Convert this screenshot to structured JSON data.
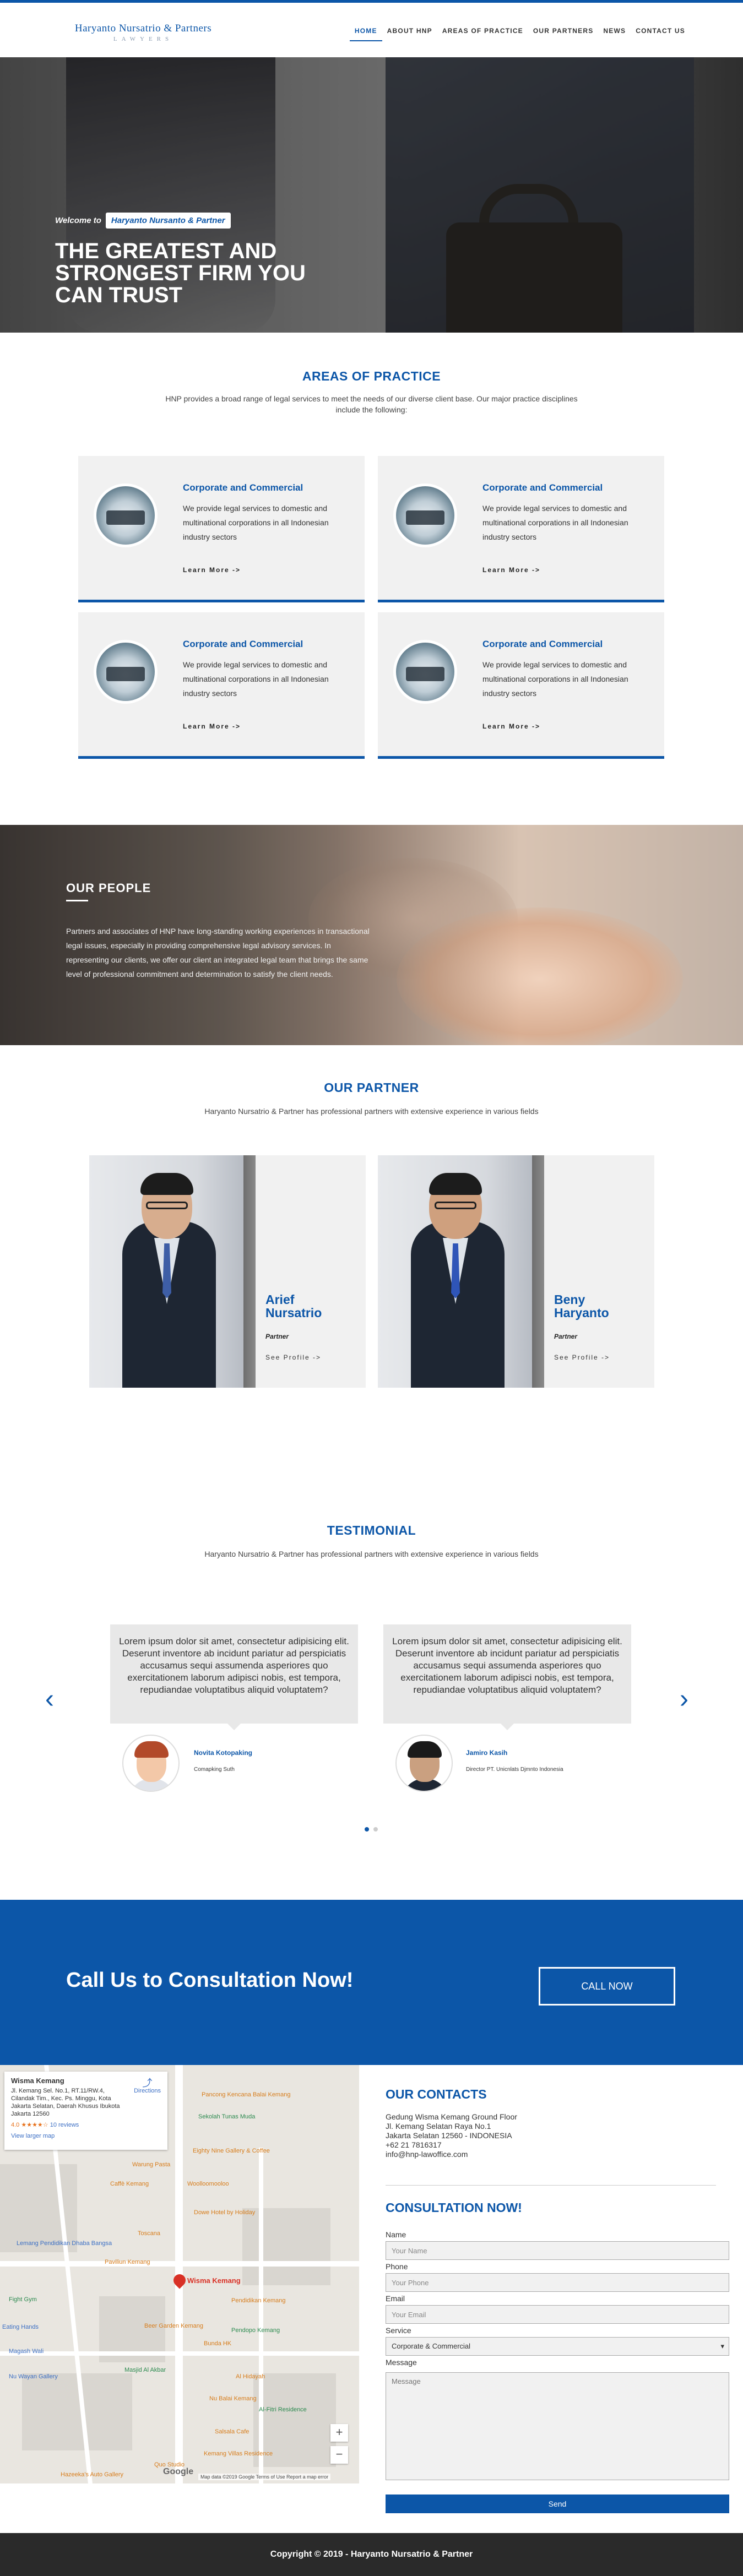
{
  "header": {
    "logo_line1": "Haryanto Nursatrio & Partners",
    "logo_line2": "LAWYERS",
    "nav": [
      "HOME",
      "ABOUT HNP",
      "AREAS OF PRACTICE",
      "OUR PARTNERS",
      "NEWS",
      "CONTACT US"
    ],
    "active_nav": "HOME",
    "accent_color": "#0c56a8"
  },
  "hero": {
    "welcome": "Welcome to",
    "badge": "Haryanto Nursanto & Partner",
    "title": "THE GREATEST AND STRONGEST FIRM YOU CAN TRUST"
  },
  "practice": {
    "title": "AREAS OF PRACTICE",
    "subtitle": "HNP provides a broad range of legal services to meet the needs of our diverse client base. Our major practice disciplines include the following:",
    "cards": [
      {
        "title": "Corporate and Commercial",
        "text": "We provide legal services to domestic and multinational corporations in all Indonesian industry sectors",
        "more": "Learn More ->"
      },
      {
        "title": "Corporate and Commercial",
        "text": "We provide legal services to domestic and multinational corporations in all Indonesian industry sectors",
        "more": "Learn More ->"
      },
      {
        "title": "Corporate and Commercial",
        "text": "We provide legal services to domestic and multinational corporations in all Indonesian industry sectors",
        "more": "Learn More ->"
      },
      {
        "title": "Corporate and Commercial",
        "text": "We provide legal services to domestic and multinational corporations in all Indonesian industry sectors",
        "more": "Learn More ->"
      }
    ]
  },
  "people": {
    "title": "OUR PEOPLE",
    "text": "Partners and associates of HNP have long-standing working experiences in transactional legal issues, especially in providing comprehensive legal advisory services. In representing our clients, we offer our client an integrated legal team that brings the same level of professional commitment and determination to satisfy the client needs."
  },
  "partners": {
    "title": "OUR PARTNER",
    "subtitle": "Haryanto Nursatrio & Partner has professional partners with extensive experience in various fields",
    "items": [
      {
        "name_line1": "Arief",
        "name_line2": "Nursatrio",
        "role": "Partner",
        "link": "See Profile ->"
      },
      {
        "name_line1": "Beny",
        "name_line2": "Haryanto",
        "role": "Partner",
        "link": "See Profile ->"
      }
    ]
  },
  "testimonial": {
    "title": "TESTIMONIAL",
    "subtitle": "Haryanto Nursatrio & Partner has professional partners with extensive experience in various fields",
    "items": [
      {
        "text": "Lorem ipsum dolor sit amet, consectetur adipisicing elit. Deserunt inventore ab incidunt pariatur ad perspiciatis accusamus sequi assumenda asperiores quo exercitationem laborum adipisci nobis, est tempora, repudiandae voluptatibus aliquid voluptatem?",
        "name": "Novita Kotopaking",
        "role": "Comapking Suth"
      },
      {
        "text": "Lorem ipsum dolor sit amet, consectetur adipisicing elit. Deserunt inventore ab incidunt pariatur ad perspiciatis accusamus sequi assumenda asperiores quo exercitationem laborum adipisci nobis, est tempora, repudiandae voluptatibus aliquid voluptatem?",
        "name": "Jamiro Kasih",
        "role": "Director PT. Unicnlats Djmnto Indonesia"
      }
    ],
    "prev_icon": "chevron-left-icon",
    "next_icon": "chevron-right-icon",
    "active_dot": 1
  },
  "cta": {
    "title": "Call Us to Consultation Now!",
    "button": "CALL NOW"
  },
  "map": {
    "place": "Wisma Kemang",
    "address": "Jl. Kemang Sel. No.1, RT.11/RW.4, Cilandak Tim., Kec. Ps. Minggu, Kota Jakarta Selatan, Daerah Khusus Ibukota Jakarta 12560",
    "rating": "4.0 ★★★★☆",
    "reviews": "10 reviews",
    "larger_map": "View larger map",
    "directions": "Directions",
    "pin_label": "Wisma Kemang",
    "pois": [
      "Pancong Kencana Balai Kemang",
      "Sekolah Tunas Muda",
      "Eighty Nine Gallery & Coffee",
      "Warung Pasta",
      "Caffè Kemang",
      "Woolloomooloo",
      "Dowe Hotel by Holiday",
      "Toscana",
      "Lemang Pendidikan Dhaba Bangsa",
      "Paviliun Kemang",
      "Pendidikan Kemang",
      "Beer Garden Kemang",
      "Pendopo Kemang",
      "Masjid Al Akbar",
      "Al Hidayah",
      "Nu Balai Kemang",
      "Salsala Cafe",
      "Kemang Villas Residence",
      "Bunda HK",
      "Al-Fitri Residence",
      "Quo Studio",
      "Hazeeka's Auto Gallery",
      "Fight Gym",
      "Magash Wali",
      "Nu Wayan Gallery",
      "Eating Hands"
    ],
    "zoom_in": "+",
    "zoom_out": "−",
    "footer": "Map data ©2019 Google  Terms of Use  Report a map error",
    "google": "Google"
  },
  "contacts": {
    "title": "OUR CONTACTS",
    "address_lines": [
      "Gedung Wisma Kemang Ground Floor",
      "Jl. Kemang Selatan Raya No.1",
      "Jakarta Selatan 12560 - INDONESIA",
      "+62 21 7816317",
      "info@hnp-lawoffice.com"
    ],
    "form_title": "CONSULTATION NOW!",
    "name_label": "Name",
    "name_placeholder": "Your Name",
    "phone_label": "Phone",
    "phone_placeholder": "Your Phone",
    "email_label": "Email",
    "email_placeholder": "Your Email",
    "service_label": "Service",
    "service_value": "Corporate & Commercial",
    "message_label": "Message",
    "message_placeholder": "Message",
    "send": "Send"
  },
  "footer": {
    "text": "Copyright © 2019 - Haryanto Nursatrio & Partner"
  }
}
